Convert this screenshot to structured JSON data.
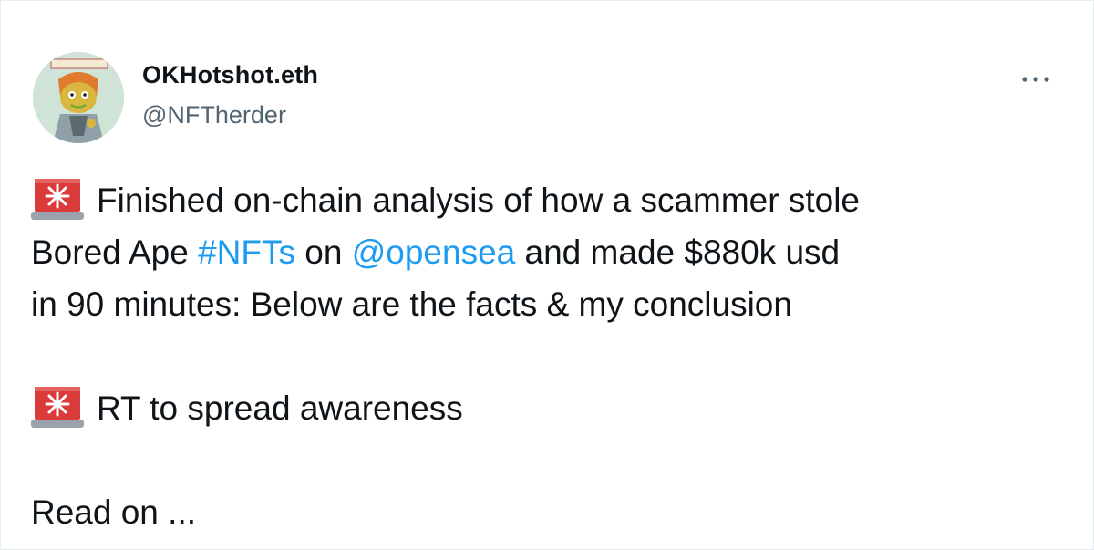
{
  "author": {
    "display_name": "OKHotshot.eth",
    "handle": "@NFTherder",
    "avatar_icon": "cartoon-avatar-icon"
  },
  "menu": {
    "more_icon": "more-options-icon",
    "more_label": "···"
  },
  "tweet": {
    "emoji_icon": "police-light-siren-icon",
    "line1": "Finished on-chain analysis of how a scammer stole",
    "line2_prefix": "Bored Ape ",
    "hashtag": "#NFTs",
    "line2_mid": " on ",
    "mention": "@opensea",
    "line2_suffix": " and made $880k usd",
    "line3": "in 90 minutes: Below are the facts & my conclusion",
    "line4": "RT to spread awareness",
    "line5": "Read on ..."
  },
  "colors": {
    "link": "#1d9bf0",
    "text": "#0f1419",
    "secondary": "#536471",
    "siren_red": "#d93a3a"
  }
}
